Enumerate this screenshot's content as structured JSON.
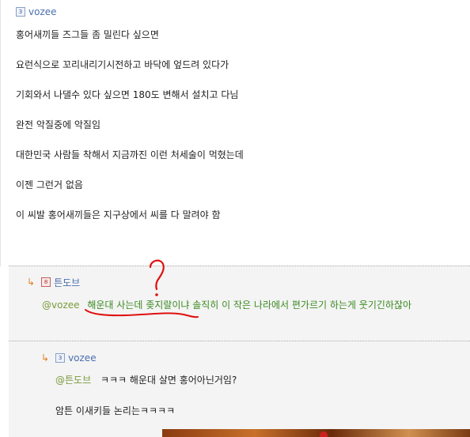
{
  "post": {
    "level": "3",
    "author": "vozee",
    "lines": [
      "홍어새끼들 즈그들 좀 밀린다 싶으면",
      "요런식으로 꼬리내리기시전하고 바닥에 엎드려 있다가",
      "기회와서 나댈수 있다 싶으면 180도 변해서 설치고 다님",
      "완전 악질중에 악질임",
      "대한민국 사람들 착해서 지금까진 이런 처세술이 먹혔는데",
      "이젠 그런거 없음",
      "이 씨발 홍어새끼들은 지구상에서 씨를 다 말려야 함"
    ]
  },
  "comments": [
    {
      "arrow": "↳",
      "level": "8",
      "author": "튼도브",
      "mention": "@vozee",
      "text": "해운대 사는데 좆지랄이냐 솔직히 이 작은 나라에서 편가르기 하는게 웃기긴하잖아"
    },
    {
      "arrow": "↳",
      "level": "3",
      "author": "vozee",
      "mention": "@튼도브",
      "text": "ㅋㅋㅋ 해운대 살면 홍어아닌거임?",
      "text2": "암튼 이새키들 논리는ㅋㅋㅋㅋ"
    }
  ],
  "annotation": {
    "mark": "?",
    "color": "#e01010"
  }
}
